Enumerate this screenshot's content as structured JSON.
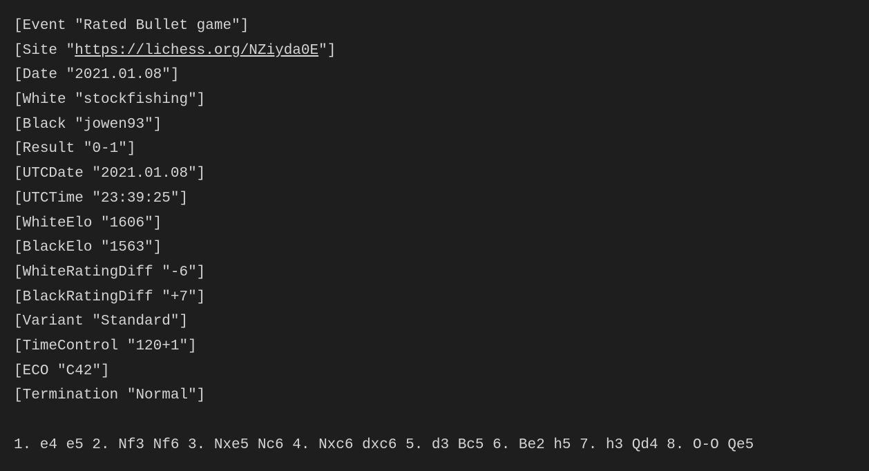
{
  "pgn": {
    "tags": [
      {
        "key": "Event",
        "value": "Rated Bullet game",
        "link": false
      },
      {
        "key": "Site",
        "value": "https://lichess.org/NZiyda0E",
        "link": true
      },
      {
        "key": "Date",
        "value": "2021.01.08",
        "link": false
      },
      {
        "key": "White",
        "value": "stockfishing",
        "link": false
      },
      {
        "key": "Black",
        "value": "jowen93",
        "link": false
      },
      {
        "key": "Result",
        "value": "0-1",
        "link": false
      },
      {
        "key": "UTCDate",
        "value": "2021.01.08",
        "link": false
      },
      {
        "key": "UTCTime",
        "value": "23:39:25",
        "link": false
      },
      {
        "key": "WhiteElo",
        "value": "1606",
        "link": false
      },
      {
        "key": "BlackElo",
        "value": "1563",
        "link": false
      },
      {
        "key": "WhiteRatingDiff",
        "value": "-6",
        "link": false
      },
      {
        "key": "BlackRatingDiff",
        "value": "+7",
        "link": false
      },
      {
        "key": "Variant",
        "value": "Standard",
        "link": false
      },
      {
        "key": "TimeControl",
        "value": "120+1",
        "link": false
      },
      {
        "key": "ECO",
        "value": "C42",
        "link": false
      },
      {
        "key": "Termination",
        "value": "Normal",
        "link": false
      }
    ],
    "moves": "1. e4 e5 2. Nf3 Nf6 3. Nxe5 Nc6 4. Nxc6 dxc6 5. d3 Bc5 6. Be2 h5 7. h3 Qd4 8. O-O Qe5"
  }
}
